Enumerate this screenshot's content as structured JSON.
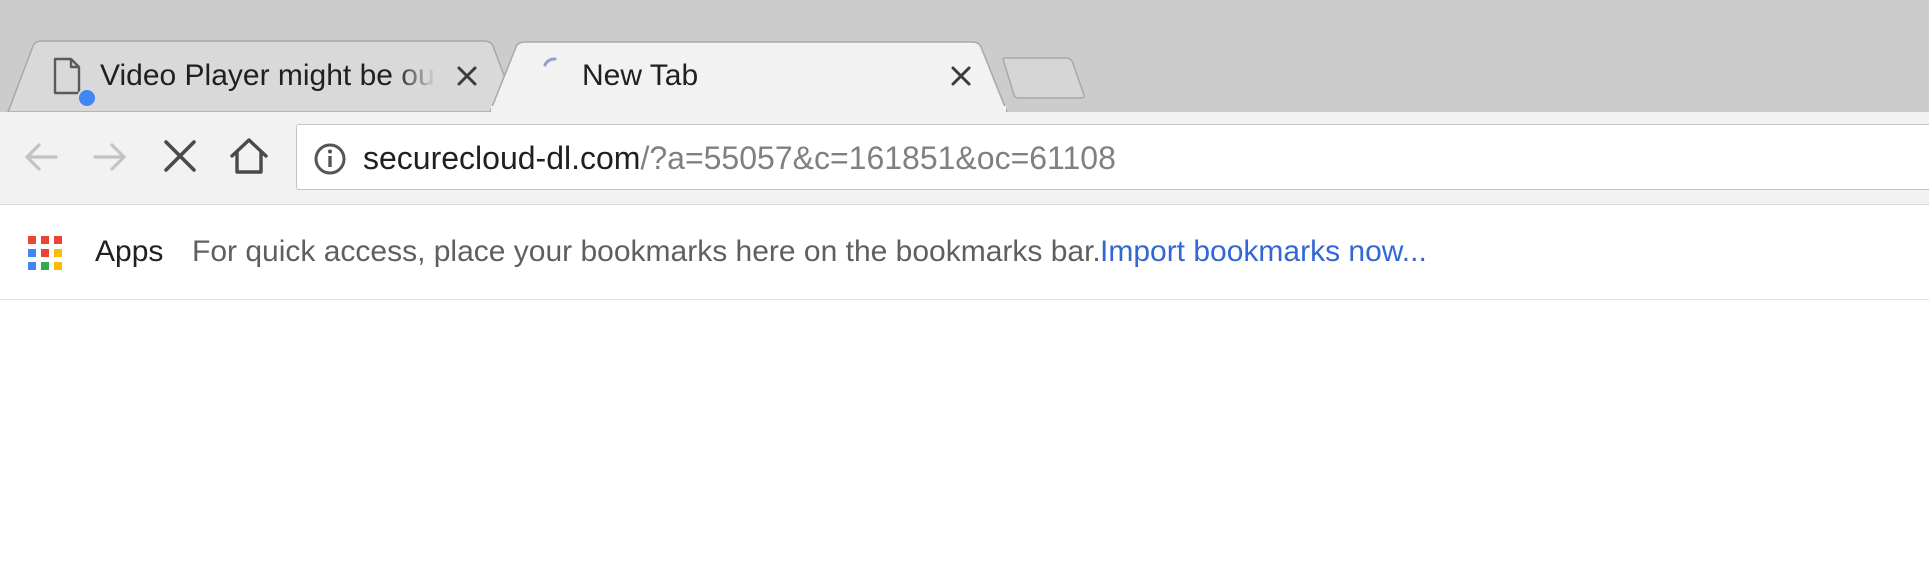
{
  "tabs": [
    {
      "title": "Video Player might be out of date",
      "active": false,
      "favicon": "document-icon",
      "badge_color": "#4285f4",
      "close_icon": "close-icon"
    },
    {
      "title": "New Tab",
      "active": true,
      "favicon": "loading-spinner-icon",
      "close_icon": "close-icon"
    }
  ],
  "new_tab_icon": "new-tab-icon",
  "toolbar": {
    "back_icon": "back-arrow-icon",
    "forward_icon": "forward-arrow-icon",
    "stop_icon": "stop-icon",
    "home_icon": "home-icon"
  },
  "omnibox": {
    "security_icon": "info-icon",
    "url_host": "securecloud-dl.com",
    "url_path": "/?a=55057&c=161851&oc=61108"
  },
  "bookmarks_bar": {
    "apps_icon": "apps-grid-icon",
    "apps_label": "Apps",
    "hint": "For quick access, place your bookmarks here on the bookmarks bar.",
    "import_link": "Import bookmarks now..."
  },
  "colors": {
    "tabstrip": "#cccccc",
    "active_tab": "#f2f2f2",
    "inactive_tab": "#d9d9d9",
    "link": "#3367d6",
    "url_path": "#808080",
    "apps_grid": [
      "#ea4335",
      "#4285f4",
      "#fbbc05",
      "#34a853"
    ]
  }
}
